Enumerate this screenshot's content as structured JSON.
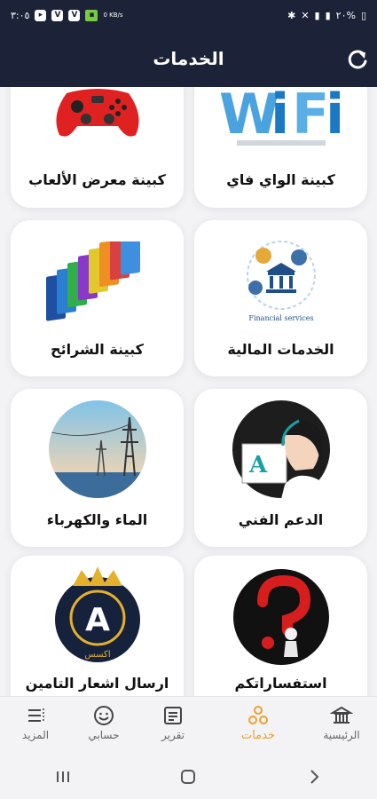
{
  "status": {
    "time": "٣:٠٥",
    "battery": "٢٠%",
    "speed": "0 KB/s"
  },
  "header": {
    "title": "الخدمات"
  },
  "cards": [
    {
      "label": "كبينة الواي فاي",
      "icon": "wifi-icon"
    },
    {
      "label": "كبينة معرض الألعاب",
      "icon": "gamepad-icon"
    },
    {
      "label": "الخدمات المالية",
      "icon": "financial-services-icon",
      "icon_text": "Financial services"
    },
    {
      "label": "كبينة الشرائح",
      "icon": "sim-cards-icon"
    },
    {
      "label": "الدعم الفني",
      "icon": "support-agent-icon"
    },
    {
      "label": "الماء والكهرباء",
      "icon": "power-tower-icon"
    },
    {
      "label": "استفساراتكم",
      "icon": "question-person-icon"
    },
    {
      "label": "ارسال اشعار التامين",
      "icon": "crown-logo-icon",
      "icon_text": "اكسس"
    }
  ],
  "nav": {
    "home": "الرئيسية",
    "services": "خدمات",
    "report": "تقرير",
    "account": "حسابي",
    "more": "المزيد"
  },
  "colors": {
    "header_bg": "#1c2339",
    "active_nav": "#f0a030"
  }
}
